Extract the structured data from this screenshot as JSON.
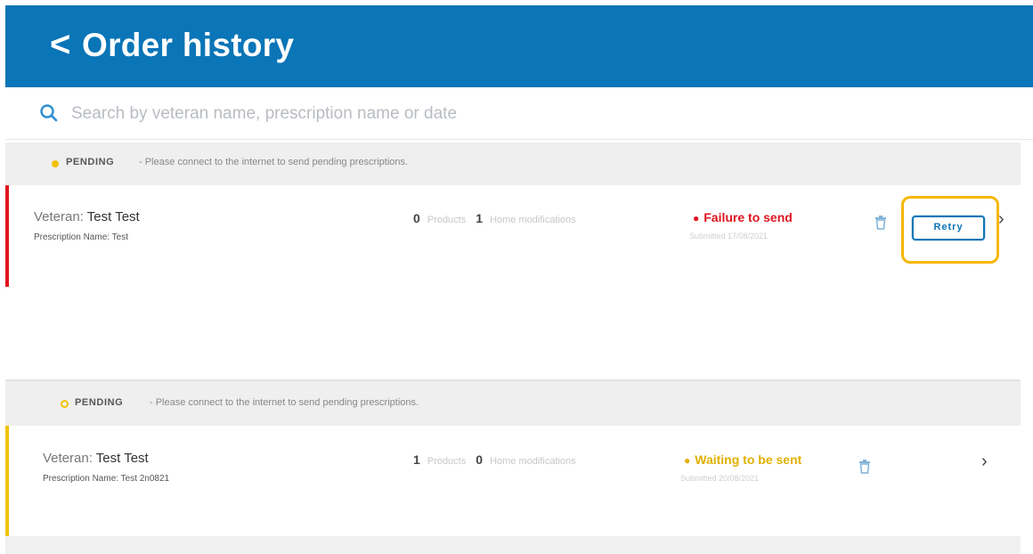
{
  "header": {
    "back_icon": "chevron-left-icon",
    "back_glyph": "<",
    "title": "Order history"
  },
  "search": {
    "icon": "search-icon",
    "placeholder": "Search by veteran name, prescription name or date"
  },
  "sections": [
    {
      "banner": {
        "status_label": "PENDING",
        "message": "- Please connect to the internet to send pending prescriptions."
      },
      "order": {
        "veteran_key": "Veteran:",
        "veteran_name": "Test Test",
        "prescription_label": "Prescription Name: Test",
        "products_count": "0",
        "products_label": "Products",
        "modifications_count": "1",
        "modifications_label": "Home modifications",
        "status_text": "Failure to send",
        "status_color": "#e0141e",
        "status_sub": "Submitted 17/08/2021",
        "retry_label": "Retry",
        "stripe_color": "#e0141e"
      }
    },
    {
      "banner": {
        "status_label": "PENDING",
        "message": "- Please connect to the internet to send pending prescriptions."
      },
      "order": {
        "veteran_key": "Veteran:",
        "veteran_name": "Test Test",
        "prescription_label": "Prescription Name: Test 2n0821",
        "products_count": "1",
        "products_label": "Products",
        "modifications_count": "0",
        "modifications_label": "Home modifications",
        "status_text": "Waiting to be sent",
        "status_color": "#e0b000",
        "status_sub": "Submitted 20/08/2021",
        "stripe_color": "#f2c200"
      }
    }
  ],
  "colors": {
    "header_bg": "#0a75b7",
    "highlight": "#f5b700"
  }
}
